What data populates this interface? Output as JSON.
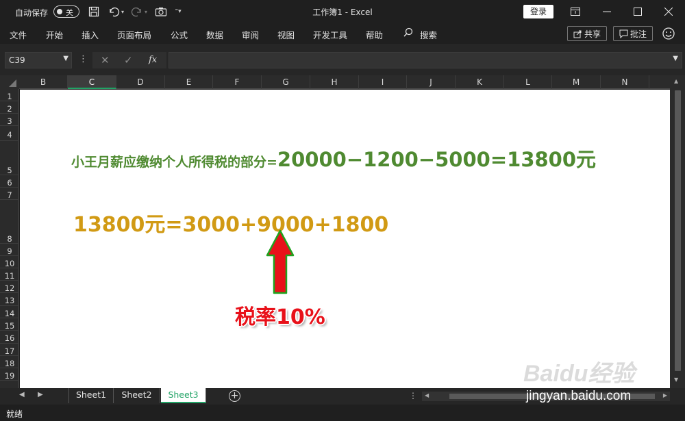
{
  "titlebar": {
    "autosave_label": "自动保存",
    "autosave_state": "关",
    "title": "工作簿1  -  Excel",
    "login_label": "登录"
  },
  "ribbon": {
    "tabs": [
      "文件",
      "开始",
      "插入",
      "页面布局",
      "公式",
      "数据",
      "审阅",
      "视图",
      "开发工具",
      "帮助",
      "搜索"
    ],
    "share_label": "共享",
    "comment_label": "批注"
  },
  "formula_bar": {
    "name_box": "C39",
    "formula": ""
  },
  "grid": {
    "columns": [
      "B",
      "C",
      "D",
      "E",
      "F",
      "G",
      "H",
      "I",
      "J",
      "K",
      "L",
      "M",
      "N"
    ],
    "selected_column": "C",
    "rows": [
      "1",
      "2",
      "3",
      "4",
      "5",
      "6",
      "7",
      "8",
      "9",
      "10",
      "11",
      "12",
      "13",
      "14",
      "15",
      "16",
      "17",
      "18",
      "19"
    ]
  },
  "content": {
    "line1_prefix": "小王月薪应缴纳个人所得税的部分=",
    "line1_formula": "20000−1200−5000=13800元",
    "line2": "13800元=3000+9000+1800",
    "annotation": "税率10%",
    "colors": {
      "green": "#4f8a31",
      "gold": "#d19a14",
      "red": "#e8111a"
    }
  },
  "sheet_tabs": {
    "tabs": [
      "Sheet1",
      "Sheet2",
      "Sheet3"
    ],
    "active": "Sheet3"
  },
  "status": "就绪",
  "watermark": {
    "logo": "Baidu经验",
    "url": "jingyan.baidu.com"
  }
}
